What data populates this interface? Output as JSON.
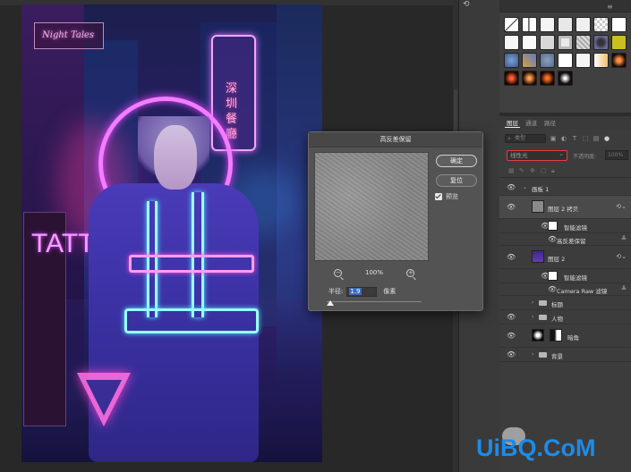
{
  "canvas": {
    "doc_tab_label": "",
    "art": {
      "sign_top": "Night Tales",
      "vertical_sign": "深圳餐廳",
      "tattoo": "TATTOO"
    }
  },
  "dialog": {
    "title": "高反差保留",
    "ok_label": "确定",
    "reset_label": "复位",
    "preview_label": "预览",
    "preview_checked": true,
    "zoom_value": "100%",
    "radius_label": "半径:",
    "radius_value": "1.9",
    "radius_unit": "像素"
  },
  "panels": {
    "layers_tabs": [
      "图层",
      "通道",
      "路径"
    ],
    "filter_kind_placeholder": "类型",
    "blend_mode": "线性光",
    "opacity_label": "不透明度:",
    "opacity_value": "100%",
    "layers": [
      {
        "id": "group1",
        "name": "画板 1",
        "type": "group",
        "expanded": true
      },
      {
        "id": "layer2copy",
        "name": "图层 2 拷贝",
        "type": "smart"
      },
      {
        "id": "sf1",
        "name": "智能滤镜",
        "type": "smart-filter"
      },
      {
        "id": "hp",
        "name": "高反差保留",
        "type": "filter"
      },
      {
        "id": "layer2",
        "name": "图层 2",
        "type": "smart"
      },
      {
        "id": "sf2",
        "name": "智能滤镜",
        "type": "smart-filter"
      },
      {
        "id": "cr",
        "name": "Camera Raw 滤镜",
        "type": "filter"
      },
      {
        "id": "g_title",
        "name": "标题",
        "type": "group"
      },
      {
        "id": "g_person",
        "name": "人物",
        "type": "group"
      },
      {
        "id": "vignette",
        "name": "暗角",
        "type": "layer"
      },
      {
        "id": "g_bg",
        "name": "背景",
        "type": "group"
      }
    ]
  },
  "watermark": "UiBQ.CoM",
  "colors": {
    "accent": "#1d8be8",
    "blend_highlight": "#e04040",
    "neon_pink": "#f37dff",
    "neon_cyan": "#9cfbff"
  }
}
